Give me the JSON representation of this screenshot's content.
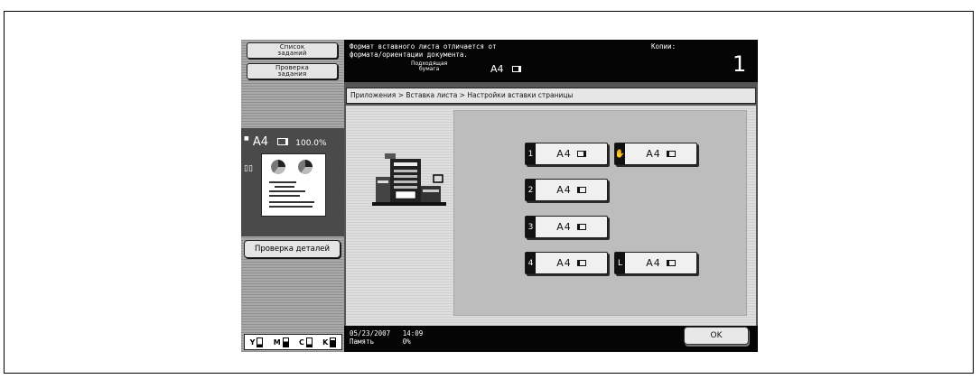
{
  "left_panel": {
    "job_list_label": "Список заданий",
    "job_check_label": "Проверка задания",
    "preview_size": "A4",
    "preview_zoom": "100.0%",
    "detail_check_label": "Проверка деталей",
    "toner": [
      {
        "color": "Y",
        "level": 0.3
      },
      {
        "color": "M",
        "level": 0.6
      },
      {
        "color": "C",
        "level": 0.3
      },
      {
        "color": "K",
        "level": 0.8
      }
    ]
  },
  "header": {
    "message_line1": "Формат вставного листа отличается от",
    "message_line2": "формата/ориентации документа.",
    "paper_label_line1": "Подходящая",
    "paper_label_line2": "бумага",
    "paper_value": "A4",
    "copies_label": "Копии:",
    "copies_value": "1"
  },
  "breadcrumb": "Приложения > Вставка листа > Настройки вставки страницы",
  "slots": [
    {
      "num": "1",
      "label": "A4",
      "orientation": "landscape"
    },
    {
      "num": "hand-icon",
      "label": "A4",
      "orientation": "portrait"
    },
    {
      "num": "2",
      "label": "A4",
      "orientation": "portrait"
    },
    {
      "num": "3",
      "label": "A4",
      "orientation": "portrait"
    },
    {
      "num": "4",
      "label": "A4",
      "orientation": "portrait"
    },
    {
      "num": "L",
      "label": "A4",
      "orientation": "portrait"
    }
  ],
  "footer": {
    "date": "05/23/2007",
    "time": "14:09",
    "memory_label": "Память",
    "memory_value": "0%",
    "ok_label": "OK"
  }
}
